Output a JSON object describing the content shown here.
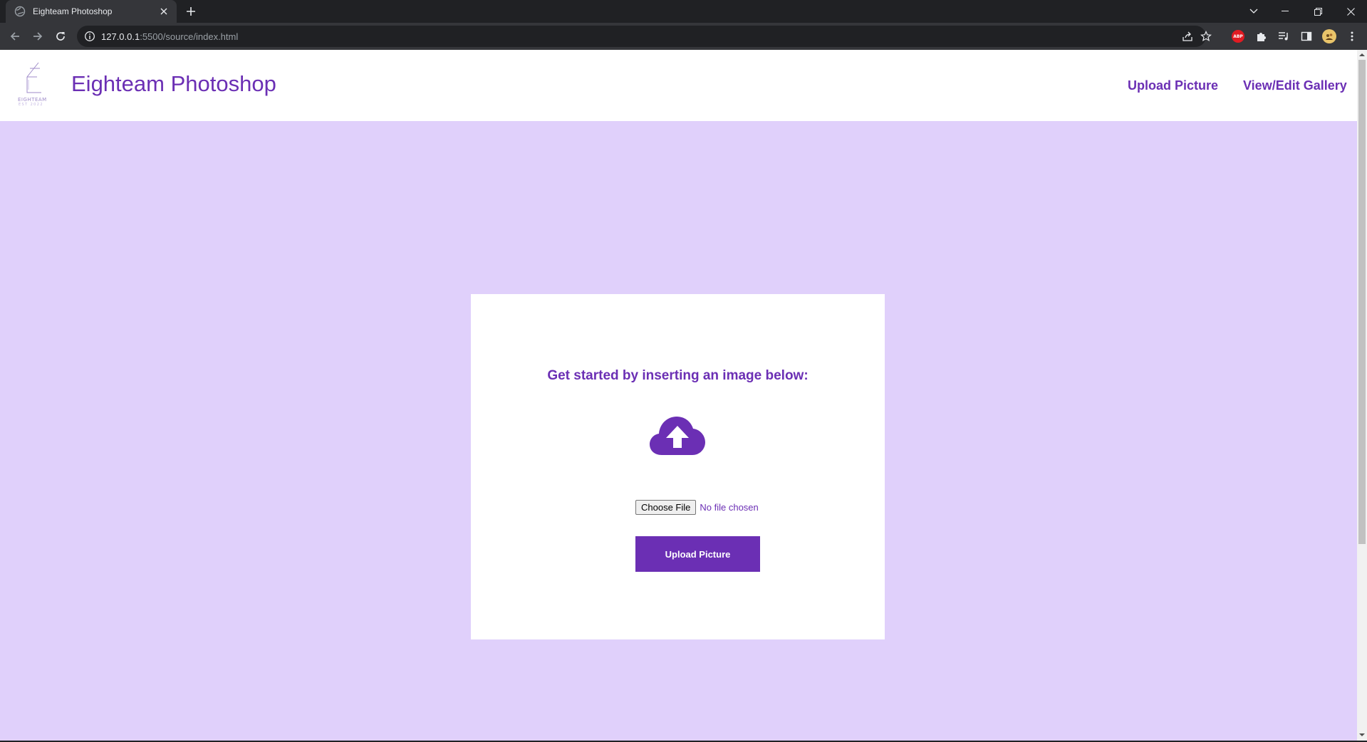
{
  "browser": {
    "tab_title": "Eighteam Photoshop",
    "url_host": "127.0.0.1",
    "url_rest": ":5500/source/index.html",
    "icons": [
      "globe-icon",
      "close-icon",
      "plus-icon",
      "chevron-down-icon",
      "minimize-icon",
      "restore-icon",
      "close-window-icon",
      "back-icon",
      "forward-icon",
      "reload-icon",
      "info-icon",
      "share-icon",
      "star-icon",
      "adblock-icon",
      "puzzle-icon",
      "media-icon",
      "sidepanel-icon",
      "profile-avatar",
      "more-icon"
    ],
    "abp_label": "ABP"
  },
  "header": {
    "logo_text": "EIGHTEAM",
    "logo_est": "EST 2022",
    "site_title": "Eighteam Photoshop",
    "nav": {
      "upload": "Upload Picture",
      "gallery": "View/Edit Gallery"
    }
  },
  "main": {
    "heading": "Get started by inserting an image below:",
    "cloud_icon": "cloud-upload-icon",
    "file_button": "Choose File",
    "file_status": "No file chosen",
    "upload_button": "Upload Picture"
  },
  "colors": {
    "brand": "#6b2fb4",
    "page_bg": "#e0d0fb",
    "card_bg": "#ffffff"
  }
}
